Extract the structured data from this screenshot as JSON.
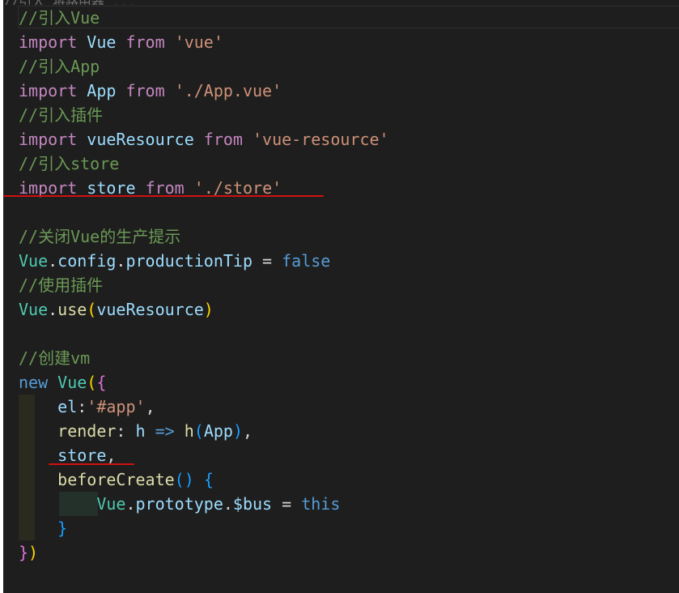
{
  "editor": {
    "top_clipped_line": "//引入 将路由器 ...",
    "lines": [
      [
        {
          "t": "//引入Vue",
          "c": "com"
        }
      ],
      [
        {
          "t": "import",
          "c": "kw"
        },
        {
          "t": " "
        },
        {
          "t": "Vue",
          "c": "var"
        },
        {
          "t": " "
        },
        {
          "t": "from",
          "c": "kw"
        },
        {
          "t": " "
        },
        {
          "t": "'vue'",
          "c": "str"
        }
      ],
      [
        {
          "t": "//引入App",
          "c": "com"
        }
      ],
      [
        {
          "t": "import",
          "c": "kw"
        },
        {
          "t": " "
        },
        {
          "t": "App",
          "c": "var"
        },
        {
          "t": " "
        },
        {
          "t": "from",
          "c": "kw"
        },
        {
          "t": " "
        },
        {
          "t": "'./App.vue'",
          "c": "str"
        }
      ],
      [
        {
          "t": "//引入插件",
          "c": "com"
        }
      ],
      [
        {
          "t": "import",
          "c": "kw"
        },
        {
          "t": " "
        },
        {
          "t": "vueResource",
          "c": "var"
        },
        {
          "t": " "
        },
        {
          "t": "from",
          "c": "kw"
        },
        {
          "t": " "
        },
        {
          "t": "'vue-resource'",
          "c": "str"
        }
      ],
      [
        {
          "t": "//引入store",
          "c": "com"
        }
      ],
      [
        {
          "t": "import",
          "c": "kw"
        },
        {
          "t": " "
        },
        {
          "t": "store",
          "c": "var"
        },
        {
          "t": " "
        },
        {
          "t": "from",
          "c": "kw"
        },
        {
          "t": " "
        },
        {
          "t": "'./store'",
          "c": "str"
        }
      ],
      [],
      [
        {
          "t": "//关闭Vue的生产提示",
          "c": "com"
        }
      ],
      [
        {
          "t": "Vue",
          "c": "cls"
        },
        {
          "t": ".",
          "c": "op"
        },
        {
          "t": "config",
          "c": "var"
        },
        {
          "t": ".",
          "c": "op"
        },
        {
          "t": "productionTip",
          "c": "var"
        },
        {
          "t": " = ",
          "c": "op"
        },
        {
          "t": "false",
          "c": "kb"
        }
      ],
      [
        {
          "t": "//使用插件",
          "c": "com"
        }
      ],
      [
        {
          "t": "Vue",
          "c": "cls"
        },
        {
          "t": ".",
          "c": "op"
        },
        {
          "t": "use",
          "c": "fn"
        },
        {
          "t": "(",
          "c": "br1"
        },
        {
          "t": "vueResource",
          "c": "var"
        },
        {
          "t": ")",
          "c": "br1"
        }
      ],
      [],
      [
        {
          "t": "//创建vm",
          "c": "com"
        }
      ],
      [
        {
          "t": "new",
          "c": "kb"
        },
        {
          "t": " "
        },
        {
          "t": "Vue",
          "c": "cls"
        },
        {
          "t": "(",
          "c": "br1"
        },
        {
          "t": "{",
          "c": "br2"
        }
      ],
      [
        {
          "t": "    "
        },
        {
          "t": "el",
          "c": "var"
        },
        {
          "t": ":",
          "c": "op"
        },
        {
          "t": "'#app'",
          "c": "str"
        },
        {
          "t": ",",
          "c": "op"
        }
      ],
      [
        {
          "t": "    "
        },
        {
          "t": "render",
          "c": "fn"
        },
        {
          "t": ": ",
          "c": "op"
        },
        {
          "t": "h",
          "c": "var"
        },
        {
          "t": " => ",
          "c": "kb"
        },
        {
          "t": "h",
          "c": "fn"
        },
        {
          "t": "(",
          "c": "br3"
        },
        {
          "t": "App",
          "c": "var"
        },
        {
          "t": ")",
          "c": "br3"
        },
        {
          "t": ",",
          "c": "op"
        }
      ],
      [
        {
          "t": "    "
        },
        {
          "t": "store",
          "c": "var"
        },
        {
          "t": ",",
          "c": "op"
        }
      ],
      [
        {
          "t": "    "
        },
        {
          "t": "beforeCreate",
          "c": "fn"
        },
        {
          "t": "()",
          "c": "br3"
        },
        {
          "t": " "
        },
        {
          "t": "{",
          "c": "br3"
        }
      ],
      [
        {
          "t": "        "
        },
        {
          "t": "Vue",
          "c": "cls"
        },
        {
          "t": ".",
          "c": "op"
        },
        {
          "t": "prototype",
          "c": "var"
        },
        {
          "t": ".",
          "c": "op"
        },
        {
          "t": "$bus",
          "c": "var"
        },
        {
          "t": " = ",
          "c": "op"
        },
        {
          "t": "this",
          "c": "kb"
        }
      ],
      [
        {
          "t": "    "
        },
        {
          "t": "}",
          "c": "br3"
        }
      ],
      [
        {
          "t": "}",
          "c": "br2"
        },
        {
          "t": ")",
          "c": "br1"
        }
      ]
    ]
  }
}
